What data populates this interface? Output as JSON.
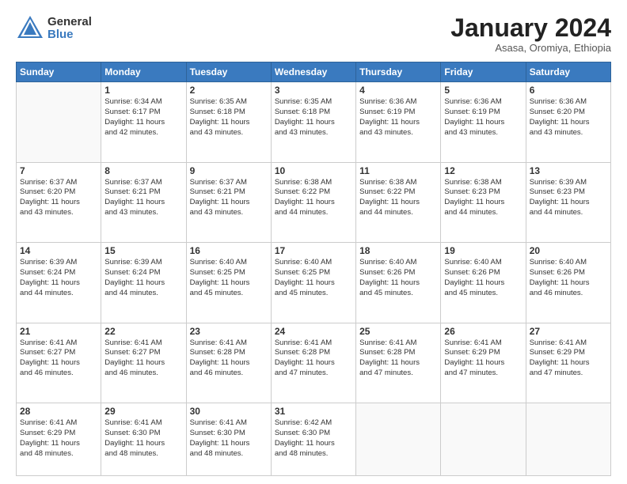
{
  "logo": {
    "general": "General",
    "blue": "Blue"
  },
  "title": "January 2024",
  "subtitle": "Asasa, Oromiya, Ethiopia",
  "days": [
    "Sunday",
    "Monday",
    "Tuesday",
    "Wednesday",
    "Thursday",
    "Friday",
    "Saturday"
  ],
  "weeks": [
    [
      {
        "day": "",
        "content": ""
      },
      {
        "day": "1",
        "content": "Sunrise: 6:34 AM\nSunset: 6:17 PM\nDaylight: 11 hours\nand 42 minutes."
      },
      {
        "day": "2",
        "content": "Sunrise: 6:35 AM\nSunset: 6:18 PM\nDaylight: 11 hours\nand 43 minutes."
      },
      {
        "day": "3",
        "content": "Sunrise: 6:35 AM\nSunset: 6:18 PM\nDaylight: 11 hours\nand 43 minutes."
      },
      {
        "day": "4",
        "content": "Sunrise: 6:36 AM\nSunset: 6:19 PM\nDaylight: 11 hours\nand 43 minutes."
      },
      {
        "day": "5",
        "content": "Sunrise: 6:36 AM\nSunset: 6:19 PM\nDaylight: 11 hours\nand 43 minutes."
      },
      {
        "day": "6",
        "content": "Sunrise: 6:36 AM\nSunset: 6:20 PM\nDaylight: 11 hours\nand 43 minutes."
      }
    ],
    [
      {
        "day": "7",
        "content": "Sunrise: 6:37 AM\nSunset: 6:20 PM\nDaylight: 11 hours\nand 43 minutes."
      },
      {
        "day": "8",
        "content": "Sunrise: 6:37 AM\nSunset: 6:21 PM\nDaylight: 11 hours\nand 43 minutes."
      },
      {
        "day": "9",
        "content": "Sunrise: 6:37 AM\nSunset: 6:21 PM\nDaylight: 11 hours\nand 43 minutes."
      },
      {
        "day": "10",
        "content": "Sunrise: 6:38 AM\nSunset: 6:22 PM\nDaylight: 11 hours\nand 44 minutes."
      },
      {
        "day": "11",
        "content": "Sunrise: 6:38 AM\nSunset: 6:22 PM\nDaylight: 11 hours\nand 44 minutes."
      },
      {
        "day": "12",
        "content": "Sunrise: 6:38 AM\nSunset: 6:23 PM\nDaylight: 11 hours\nand 44 minutes."
      },
      {
        "day": "13",
        "content": "Sunrise: 6:39 AM\nSunset: 6:23 PM\nDaylight: 11 hours\nand 44 minutes."
      }
    ],
    [
      {
        "day": "14",
        "content": "Sunrise: 6:39 AM\nSunset: 6:24 PM\nDaylight: 11 hours\nand 44 minutes."
      },
      {
        "day": "15",
        "content": "Sunrise: 6:39 AM\nSunset: 6:24 PM\nDaylight: 11 hours\nand 44 minutes."
      },
      {
        "day": "16",
        "content": "Sunrise: 6:40 AM\nSunset: 6:25 PM\nDaylight: 11 hours\nand 45 minutes."
      },
      {
        "day": "17",
        "content": "Sunrise: 6:40 AM\nSunset: 6:25 PM\nDaylight: 11 hours\nand 45 minutes."
      },
      {
        "day": "18",
        "content": "Sunrise: 6:40 AM\nSunset: 6:26 PM\nDaylight: 11 hours\nand 45 minutes."
      },
      {
        "day": "19",
        "content": "Sunrise: 6:40 AM\nSunset: 6:26 PM\nDaylight: 11 hours\nand 45 minutes."
      },
      {
        "day": "20",
        "content": "Sunrise: 6:40 AM\nSunset: 6:26 PM\nDaylight: 11 hours\nand 46 minutes."
      }
    ],
    [
      {
        "day": "21",
        "content": "Sunrise: 6:41 AM\nSunset: 6:27 PM\nDaylight: 11 hours\nand 46 minutes."
      },
      {
        "day": "22",
        "content": "Sunrise: 6:41 AM\nSunset: 6:27 PM\nDaylight: 11 hours\nand 46 minutes."
      },
      {
        "day": "23",
        "content": "Sunrise: 6:41 AM\nSunset: 6:28 PM\nDaylight: 11 hours\nand 46 minutes."
      },
      {
        "day": "24",
        "content": "Sunrise: 6:41 AM\nSunset: 6:28 PM\nDaylight: 11 hours\nand 47 minutes."
      },
      {
        "day": "25",
        "content": "Sunrise: 6:41 AM\nSunset: 6:28 PM\nDaylight: 11 hours\nand 47 minutes."
      },
      {
        "day": "26",
        "content": "Sunrise: 6:41 AM\nSunset: 6:29 PM\nDaylight: 11 hours\nand 47 minutes."
      },
      {
        "day": "27",
        "content": "Sunrise: 6:41 AM\nSunset: 6:29 PM\nDaylight: 11 hours\nand 47 minutes."
      }
    ],
    [
      {
        "day": "28",
        "content": "Sunrise: 6:41 AM\nSunset: 6:29 PM\nDaylight: 11 hours\nand 48 minutes."
      },
      {
        "day": "29",
        "content": "Sunrise: 6:41 AM\nSunset: 6:30 PM\nDaylight: 11 hours\nand 48 minutes."
      },
      {
        "day": "30",
        "content": "Sunrise: 6:41 AM\nSunset: 6:30 PM\nDaylight: 11 hours\nand 48 minutes."
      },
      {
        "day": "31",
        "content": "Sunrise: 6:42 AM\nSunset: 6:30 PM\nDaylight: 11 hours\nand 48 minutes."
      },
      {
        "day": "",
        "content": ""
      },
      {
        "day": "",
        "content": ""
      },
      {
        "day": "",
        "content": ""
      }
    ]
  ]
}
